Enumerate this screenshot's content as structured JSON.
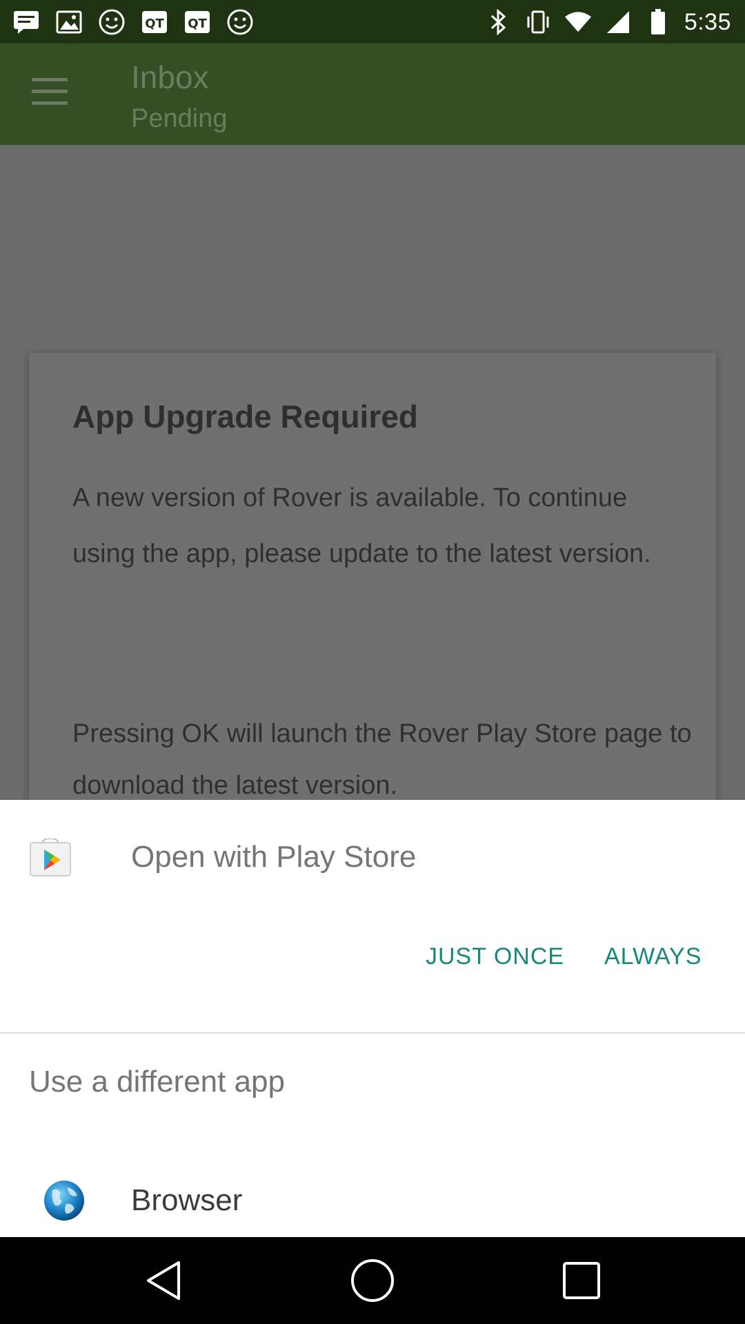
{
  "status_bar": {
    "time": "5:35",
    "left_icons": [
      "message-icon",
      "image-icon",
      "smiley-icon",
      "qq-icon",
      "qq-icon",
      "smiley-icon"
    ],
    "right_icons": [
      "bluetooth-icon",
      "vibrate-icon",
      "wifi-icon",
      "signal-icon",
      "battery-icon"
    ]
  },
  "app_bar": {
    "title": "Inbox",
    "subtitle": "Pending"
  },
  "dialog": {
    "title": "App Upgrade Required",
    "body": "A new version of Rover is available. To continue using the app, please update to the latest version.",
    "body2": "Pressing OK will launch the Rover Play Store page to download the latest version."
  },
  "chooser": {
    "open_with": "Open with Play Store",
    "just_once": "JUST ONCE",
    "always": "ALWAYS",
    "different_app": "Use a different app",
    "browser": "Browser"
  },
  "colors": {
    "accent": "#16887a",
    "status_bar_bg": "#1f3212",
    "app_bar_bg_dimmed": "#344f23"
  }
}
